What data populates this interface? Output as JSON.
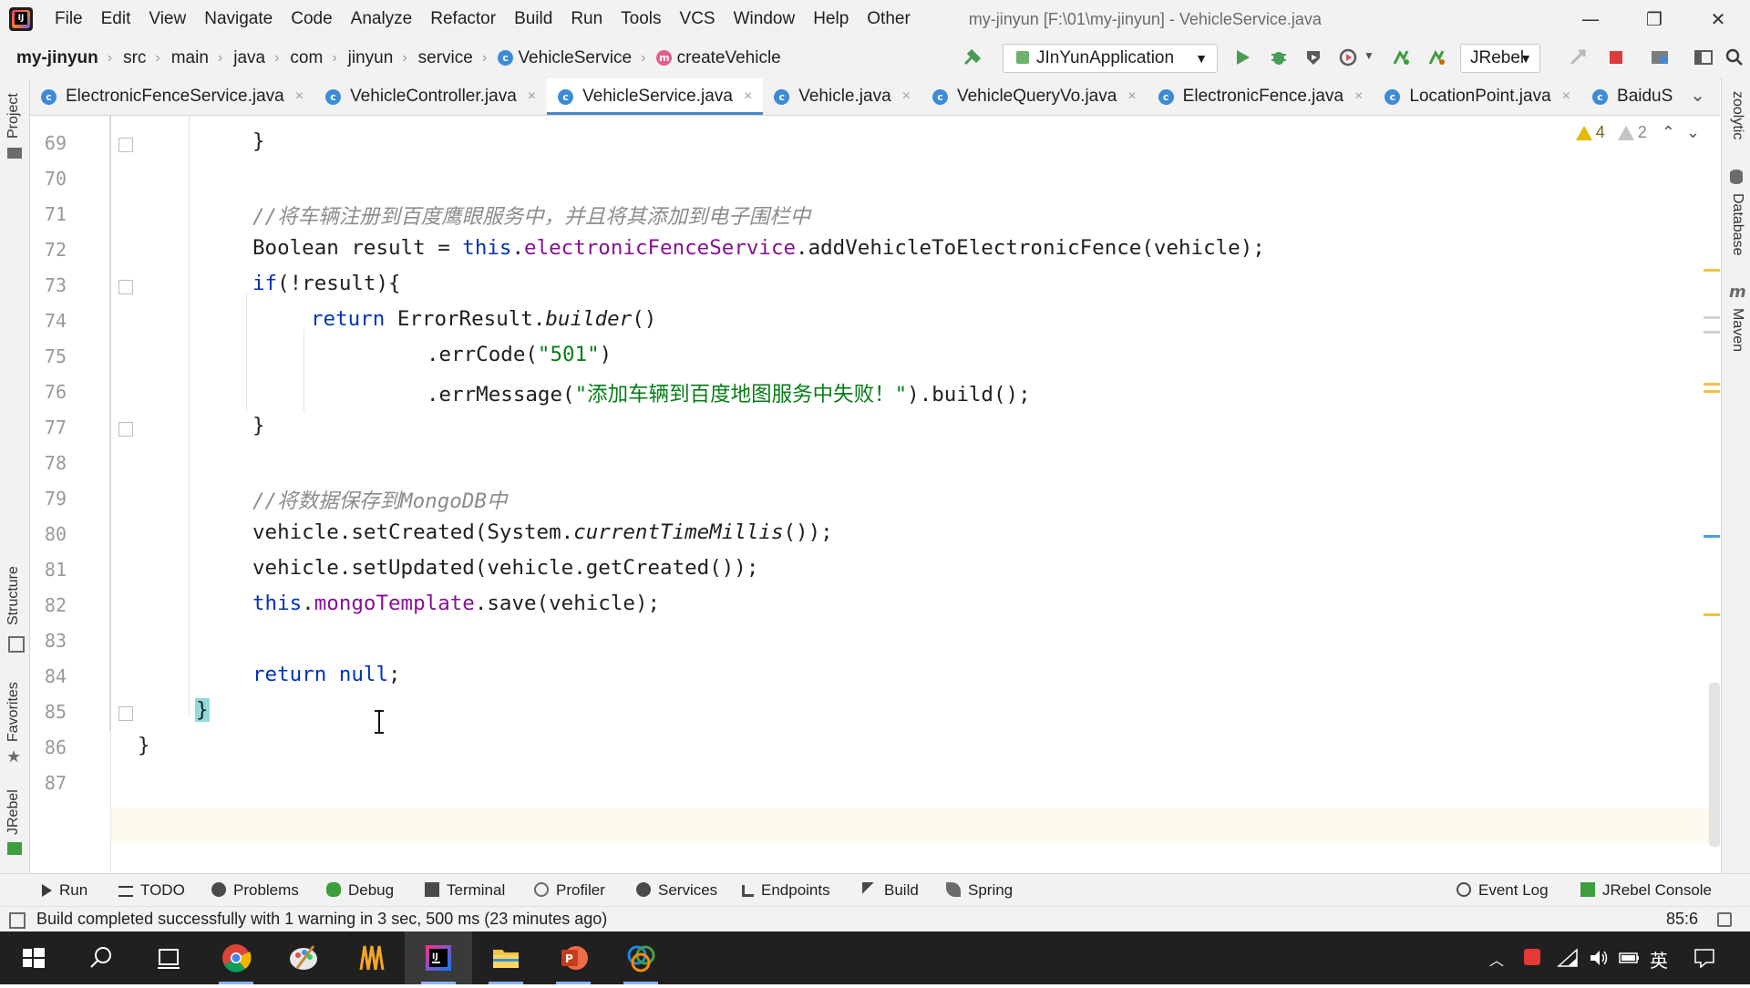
{
  "menubar": {
    "items": [
      "File",
      "Edit",
      "View",
      "Navigate",
      "Code",
      "Analyze",
      "Refactor",
      "Build",
      "Run",
      "Tools",
      "VCS",
      "Window",
      "Help",
      "Other"
    ],
    "window_title": "my-jinyun [F:\\01\\my-jinyun] - VehicleService.java",
    "minimize": "—",
    "restore": "❐",
    "close": "✕"
  },
  "navbar": {
    "breadcrumbs": [
      "my-jinyun",
      "src",
      "main",
      "java",
      "com",
      "jinyun",
      "service"
    ],
    "class_crumb": "VehicleService",
    "method_crumb": "createVehicle",
    "run_config": "JInYunApplication",
    "jrebel": "JRebel"
  },
  "tabs": [
    {
      "label": "ElectronicFenceService.java",
      "active": false
    },
    {
      "label": "VehicleController.java",
      "active": false
    },
    {
      "label": "VehicleService.java",
      "active": true
    },
    {
      "label": "Vehicle.java",
      "active": false
    },
    {
      "label": "VehicleQueryVo.java",
      "active": false
    },
    {
      "label": "ElectronicFence.java",
      "active": false
    },
    {
      "label": "LocationPoint.java",
      "active": false
    },
    {
      "label": "BaiduS",
      "active": false
    }
  ],
  "tab_close": "×",
  "tab_overflow": "⌄",
  "left_tools": {
    "project": "Project",
    "structure": "Structure",
    "favorites": "Favorites",
    "jrebel": "JRebel"
  },
  "right_tools": {
    "zoolytic": "zoolytic",
    "database": "Database",
    "maven": "Maven"
  },
  "inspections": {
    "warnings": "4",
    "weak_warnings": "2"
  },
  "editor": {
    "line_numbers": [
      "69",
      "70",
      "71",
      "72",
      "73",
      "74",
      "75",
      "76",
      "77",
      "78",
      "79",
      "80",
      "81",
      "82",
      "83",
      "84",
      "85",
      "86",
      "87"
    ],
    "lines": {
      "l69": "}",
      "l71": "//将车辆注册到百度鹰眼服务中，并且将其添加到电子围栏中",
      "l72_a": "Boolean result = ",
      "l72_b": "this",
      "l72_c": ".",
      "l72_d": "electronicFenceService",
      "l72_e": ".addVehicleToElectronicFence(vehicle);",
      "l73_a": "if",
      "l73_b": "(!result){",
      "l74_a": "return",
      "l74_b": " ErrorResult.",
      "l74_c": "builder",
      "l74_d": "()",
      "l75_a": ".errCode(",
      "l75_b": "\"501\"",
      "l75_c": ")",
      "l76_a": ".errMessage(",
      "l76_b": "\"添加车辆到百度地图服务中失败！\"",
      "l76_c": ").build();",
      "l77": "}",
      "l79": "//将数据保存到MongoDB中",
      "l80_a": "vehicle.setCreated(System.",
      "l80_b": "currentTimeMillis",
      "l80_c": "());",
      "l81": "vehicle.setUpdated(vehicle.getCreated());",
      "l82_a": "this",
      "l82_b": ".",
      "l82_c": "mongoTemplate",
      "l82_d": ".save(vehicle);",
      "l84_a": "return",
      "l84_b": " ",
      "l84_c": "null",
      "l84_d": ";",
      "l85": "}",
      "l86": "}"
    }
  },
  "bottom_tools": [
    "Run",
    "TODO",
    "Problems",
    "Debug",
    "Terminal",
    "Profiler",
    "Services",
    "Endpoints",
    "Build",
    "Spring"
  ],
  "bottom_right_tools": [
    "Event Log",
    "JRebel Console"
  ],
  "status": {
    "message": "Build completed successfully with 1 warning in 3 sec, 500 ms (23 minutes ago)",
    "caret": "85:6"
  },
  "taskbar": {
    "ime": "英",
    "apps": [
      "start",
      "search",
      "task-view",
      "chrome",
      "paint",
      "jetbrains-toolbox",
      "intellij",
      "file-explorer",
      "powerpoint",
      "other-app"
    ]
  },
  "colors": {
    "keyword": "#0033b3",
    "field": "#871094",
    "string": "#067d17",
    "comment": "#8c8c8c",
    "tab_underline": "#4a88c7",
    "current_line": "#fcfaed"
  }
}
